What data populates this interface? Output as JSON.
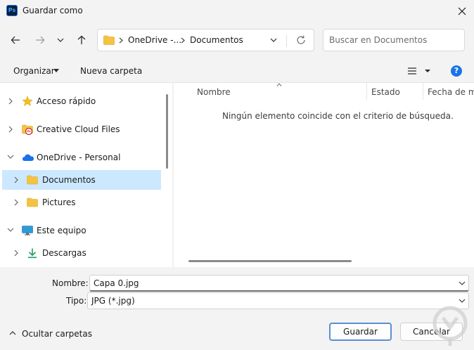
{
  "window": {
    "title": "Guardar como",
    "app_icon_text": "Ps"
  },
  "address": {
    "crumbs": [
      "OneDrive -...",
      "Documentos"
    ]
  },
  "search": {
    "placeholder": "Buscar en Documentos"
  },
  "toolbar": {
    "organize_label": "Organizar",
    "new_folder_label": "Nueva carpeta"
  },
  "nav": {
    "items": [
      {
        "label": "Acceso rápido",
        "icon": "star-icon"
      },
      {
        "label": "Creative Cloud Files",
        "icon": "creative-cloud-icon"
      },
      {
        "label": "OneDrive - Personal",
        "icon": "cloud-icon"
      },
      {
        "label": "Documentos",
        "icon": "folder-icon",
        "selected": true
      },
      {
        "label": "Pictures",
        "icon": "folder-icon"
      },
      {
        "label": "Este equipo",
        "icon": "monitor-icon"
      },
      {
        "label": "Descargas",
        "icon": "download-icon"
      }
    ]
  },
  "content": {
    "columns": [
      "Nombre",
      "Estado",
      "Fecha de mo"
    ],
    "empty_message": "Ningún elemento coincide con el criterio de búsqueda."
  },
  "form": {
    "name_label": "Nombre:",
    "name_value": "Capa 0.jpg",
    "type_label": "Tipo:",
    "type_value": "JPG (*.jpg)"
  },
  "footer": {
    "hide_folders_label": "Ocultar carpetas",
    "save_label": "Guardar",
    "cancel_label": "Cancelar"
  },
  "colors": {
    "selection": "#cce8ff",
    "accent": "#1a73e8",
    "folder": "#f5c342"
  }
}
